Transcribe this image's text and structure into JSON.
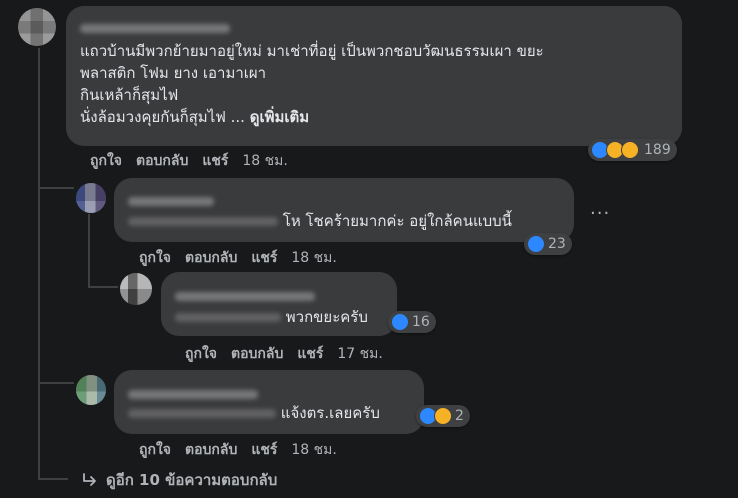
{
  "comments": [
    {
      "author_blurred": true,
      "text_lines": [
        "แถวบ้านมีพวกย้ายมาอยู่ใหม่ มาเช่าที่อยู่ เป็นพวกชอบวัฒนธรรมเผา ขยะ",
        "พลาสติก โฟม ยาง เอามาเผา",
        "กินเหล้าก็สุมไฟ",
        "นั่งล้อมวงคุยกันก็สุมไฟ ... "
      ],
      "see_more": "ดูเพิ่มเติม",
      "actions": {
        "like": "ถูกใจ",
        "reply": "ตอบกลับ",
        "share": "แชร์",
        "time": "18 ชม."
      },
      "reaction_count": "189",
      "reaction_icons": [
        "like-icon",
        "sad-icon",
        "haha-icon"
      ]
    }
  ],
  "replies": [
    {
      "text": "โห โชคร้ายมากค่ะ อยู่ใกล้คนแบบนี้",
      "actions": {
        "like": "ถูกใจ",
        "reply": "ตอบกลับ",
        "share": "แชร์",
        "time": "18 ชม."
      },
      "reaction_count": "23",
      "reaction_icons": [
        "like-icon"
      ],
      "more_options": "..."
    },
    {
      "text": "พวกขยะครับ",
      "actions": {
        "like": "ถูกใจ",
        "reply": "ตอบกลับ",
        "share": "แชร์",
        "time": "17 ชม."
      },
      "reaction_count": "16",
      "reaction_icons": [
        "like-icon"
      ]
    },
    {
      "text": "แจ้งตร.เลยครับ",
      "actions": {
        "like": "ถูกใจ",
        "reply": "ตอบกลับ",
        "share": "แชร์",
        "time": "18 ชม."
      },
      "reaction_count": "2",
      "reaction_icons": [
        "like-icon",
        "haha-icon"
      ]
    }
  ],
  "view_more_replies": "ดูอีก 10 ข้อความตอบกลับ",
  "colors": {
    "background": "#18191a",
    "bubble": "#3a3b3c",
    "text": "#e4e6eb",
    "secondary": "#b0b3b8",
    "like_blue": "#2d88ff",
    "emoji_yellow": "#f7b125"
  }
}
